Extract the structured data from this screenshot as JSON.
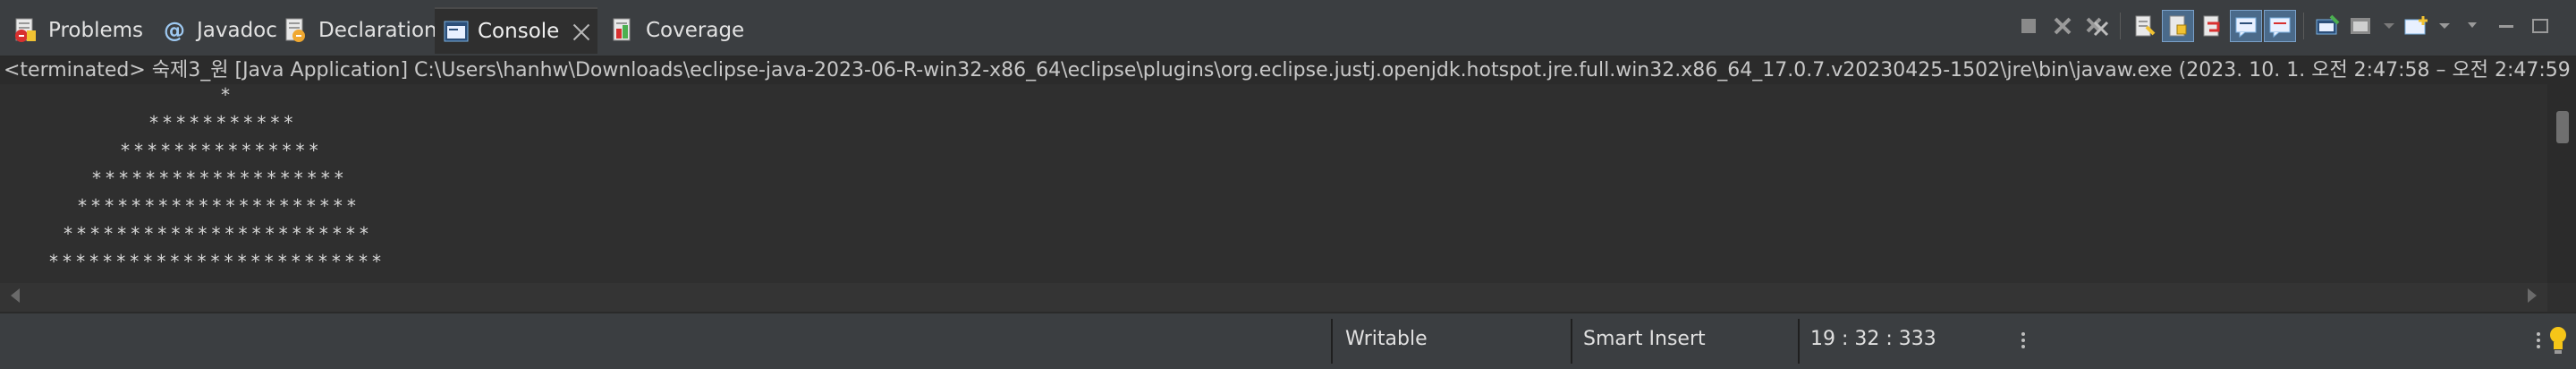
{
  "tabs": [
    {
      "label": "Problems",
      "icon": "problems-icon",
      "active": false
    },
    {
      "label": "Javadoc",
      "icon": "javadoc-icon",
      "active": false
    },
    {
      "label": "Declaration",
      "icon": "declaration-icon",
      "active": false
    },
    {
      "label": "Console",
      "icon": "console-icon",
      "active": true
    },
    {
      "label": "Coverage",
      "icon": "coverage-icon",
      "active": false
    }
  ],
  "header": {
    "text": "<terminated> 숙제3_원 [Java Application] C:\\Users\\hanhw\\Downloads\\eclipse-java-2023-06-R-win32-x86_64\\eclipse\\plugins\\org.eclipse.justj.openjdk.hotspot.jre.full.win32.x86_64_17.0.7.v20230425-1502\\jre\\bin\\javaw.exe  (2023. 10. 1. 오전 2:47:58 – 오전 2:47:59"
  },
  "console_lines": [
    "*",
    "***********",
    "***************",
    "*******************",
    "*********************",
    "***********************",
    "*************************"
  ],
  "status": {
    "writable": "Writable",
    "insert_mode": "Smart Insert",
    "position": "19 : 32 : 333"
  },
  "colors": {
    "accent": "#4a6a8a",
    "background": "#2f2f2f",
    "bar": "#3b3e41"
  }
}
